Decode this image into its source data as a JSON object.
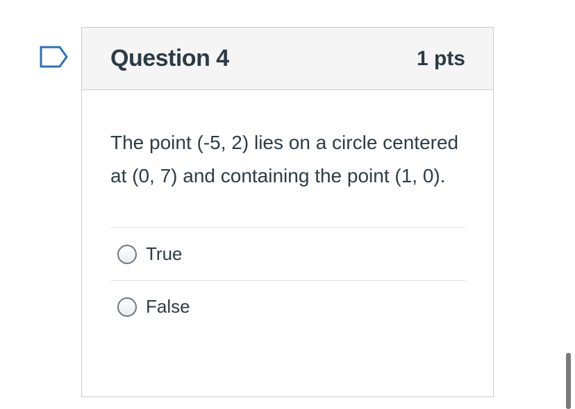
{
  "question": {
    "title": "Question 4",
    "points": "1 pts",
    "text": "The point (-5, 2) lies on a circle centered at (0, 7) and containing the point (1, 0).",
    "answers": [
      {
        "label": "True",
        "selected": false
      },
      {
        "label": "False",
        "selected": false
      }
    ]
  },
  "icons": {
    "flag": "flag-question-icon",
    "radio": "radio-button-icon"
  },
  "colors": {
    "text": "#2d3b45",
    "header_bg": "#f5f5f5",
    "border": "#c7cdd1",
    "flag_stroke": "#2d6fb6"
  }
}
